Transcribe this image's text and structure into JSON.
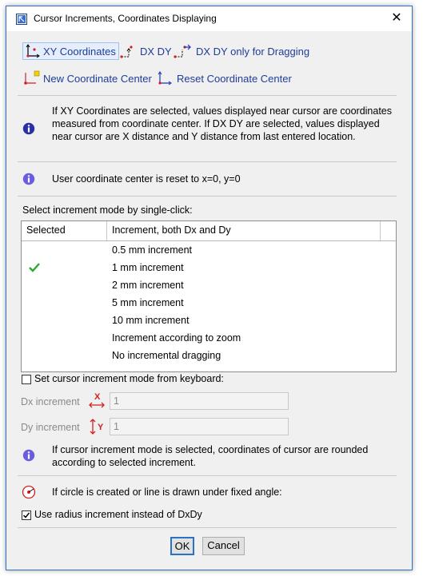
{
  "window": {
    "title": "Cursor Increments, Coordinates Displaying",
    "close_glyph": "✕"
  },
  "modes": {
    "xy": "XY Coordinates",
    "dxdy": "DX DY",
    "dxdy_drag": "DX DY only for Dragging",
    "new_center": "New Coordinate Center",
    "reset_center": "Reset Coordinate Center"
  },
  "info": {
    "xy_explanation": "If XY Coordinates are selected, values displayed near cursor are coordinates measured from coordinate center. If DX DY are selected, values displayed near cursor are X distance and Y distance from last entered location.",
    "center_reset": "User coordinate center is reset to x=0, y=0"
  },
  "increment": {
    "prompt": "Select increment mode by single-click:",
    "columns": {
      "selected": "Selected",
      "increment": "Increment, both Dx and Dy"
    },
    "rows": [
      {
        "label": "0.5 mm increment",
        "selected": false
      },
      {
        "label": "1 mm increment",
        "selected": true
      },
      {
        "label": "2 mm increment",
        "selected": false
      },
      {
        "label": "5 mm increment",
        "selected": false
      },
      {
        "label": "10 mm increment",
        "selected": false
      },
      {
        "label": "Increment according to zoom",
        "selected": false
      },
      {
        "label": "No incremental dragging",
        "selected": false
      }
    ],
    "check_color": "#2ea82e"
  },
  "keyboard": {
    "checkbox_label": "Set cursor increment mode from keyboard:",
    "checked": false,
    "dx_label": "Dx increment",
    "dx_value": "1",
    "dy_label": "Dy increment",
    "dy_value": "1",
    "note": "If cursor increment mode is selected, coordinates of cursor are rounded according to selected increment."
  },
  "circle": {
    "note": "If circle is created or line is drawn under fixed angle:",
    "checkbox_label": "Use radius increment instead of DxDy",
    "checked": true
  },
  "buttons": {
    "ok": "OK",
    "cancel": "Cancel"
  },
  "colors": {
    "accent": "#2b72c7",
    "link_text": "#1f3c9a",
    "icon_red": "#d42020",
    "icon_blue": "#2030c0"
  }
}
